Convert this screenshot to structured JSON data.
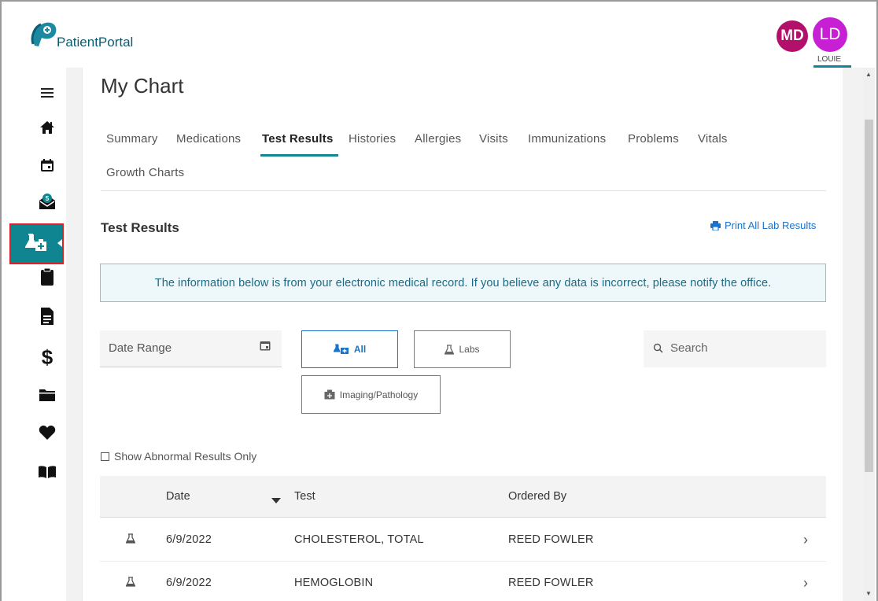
{
  "brand": {
    "name": "PatientPortal"
  },
  "header": {
    "avatars": [
      {
        "initials": "MD",
        "color": "#b2106b"
      },
      {
        "initials": "LD",
        "color": "#c61fd4"
      }
    ],
    "current_user_name": "LOUIE"
  },
  "nav": {
    "items": [
      {
        "icon": "menu-icon"
      },
      {
        "icon": "home-icon"
      },
      {
        "icon": "calendar-icon"
      },
      {
        "icon": "mail-icon",
        "badge": "5"
      },
      {
        "icon": "test-results-icon",
        "active": true
      },
      {
        "icon": "clipboard-icon"
      },
      {
        "icon": "document-icon"
      },
      {
        "icon": "dollar-icon"
      },
      {
        "icon": "folder-icon"
      },
      {
        "icon": "heart-icon"
      },
      {
        "icon": "book-icon"
      }
    ]
  },
  "page": {
    "title": "My Chart"
  },
  "tabs": [
    {
      "label": "Summary"
    },
    {
      "label": "Medications"
    },
    {
      "label": "Test Results",
      "active": true
    },
    {
      "label": "Histories"
    },
    {
      "label": "Allergies"
    },
    {
      "label": "Visits"
    },
    {
      "label": "Immunizations"
    },
    {
      "label": "Problems"
    },
    {
      "label": "Vitals"
    },
    {
      "label": "Growth Charts"
    }
  ],
  "section": {
    "title": "Test Results",
    "print_label": "Print All Lab Results"
  },
  "info_message": "The information below is from your electronic medical record. If you believe any data is incorrect, please notify the office.",
  "filters": {
    "date_range_label": "Date Range",
    "buttons": [
      {
        "label": "All",
        "active": true
      },
      {
        "label": "Labs"
      },
      {
        "label": "Imaging/Pathology"
      }
    ],
    "search_placeholder": "Search",
    "abnormal_label": "Show Abnormal Results Only"
  },
  "table": {
    "columns": [
      "Date",
      "Test",
      "Ordered By"
    ],
    "rows": [
      {
        "date": "6/9/2022",
        "test": "CHOLESTEROL, TOTAL",
        "ordered_by": "REED FOWLER"
      },
      {
        "date": "6/9/2022",
        "test": "HEMOGLOBIN",
        "ordered_by": "REED FOWLER"
      }
    ]
  },
  "colors": {
    "accent": "#128693",
    "link": "#1a73c9",
    "info_bg": "#eef8fb",
    "info_border": "#7cc9d6"
  }
}
